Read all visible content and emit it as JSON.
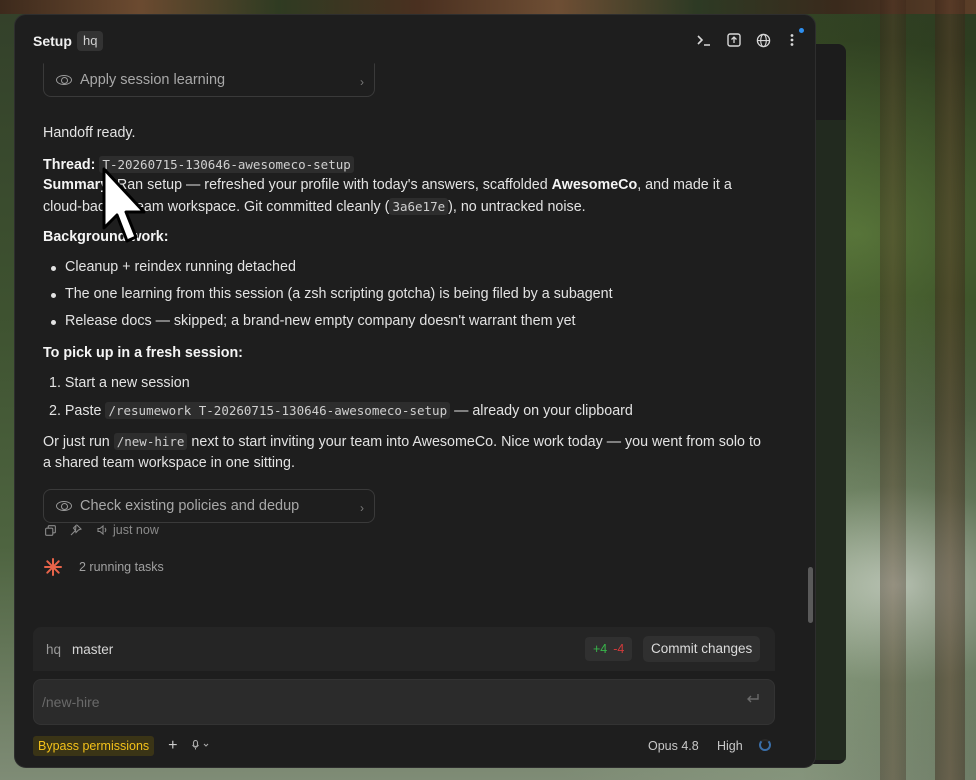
{
  "window": {
    "title": "Setup",
    "tag": "hq"
  },
  "toolbar": {
    "icons": [
      "terminal-icon",
      "export-icon",
      "globe-icon",
      "more-icon"
    ]
  },
  "top_pill": {
    "label": "Apply session learning"
  },
  "message": {
    "handoff": "Handoff ready.",
    "thread_label": "Thread:",
    "thread_id": "T-20260715-130646-awesomeco-setup",
    "summary_label": "Summary:",
    "summary_text_1": " Ran setup — refreshed your profile with today's answers, scaffolded ",
    "summary_company": "AwesomeCo",
    "summary_text_2": ", and made it a cloud-backed team workspace. Git committed cleanly (",
    "summary_commit": "3a6e17e",
    "summary_text_3": "), no untracked noise.",
    "background_label": "Background work:",
    "background_items": [
      "Cleanup + reindex running detached",
      "The one learning from this session (a zsh scripting gotcha) is being filed by a subagent",
      "Release docs — skipped; a brand-new empty company doesn't warrant them yet"
    ],
    "fresh_label": "To pick up in a fresh session:",
    "steps": {
      "s1": "1. Start a new session",
      "s2_prefix": "2. Paste ",
      "s2_code": "/resumework T-20260715-130646-awesomeco-setup",
      "s2_suffix": " — already on your clipboard"
    },
    "closing_prefix": "Or just run ",
    "closing_code": "/new-hire",
    "closing_suffix": " next to start inviting your team into AwesomeCo. Nice work today — you went from solo to a shared team workspace in one sitting."
  },
  "bottom_pill": {
    "label": "Check existing policies and dedup"
  },
  "meta": {
    "timestamp": "just now"
  },
  "running": {
    "label": "2 running tasks"
  },
  "git": {
    "repo": "hq",
    "branch": "master",
    "added": "+4",
    "removed": "-4",
    "commit_label": "Commit changes"
  },
  "composer": {
    "placeholder": "/new-hire"
  },
  "footer": {
    "permissions": "Bypass permissions",
    "plus": "+",
    "model": "Opus 4.8",
    "effort": "High"
  },
  "colors": {
    "accent_warning": "#f3c11a",
    "diff_add": "#38b64a",
    "diff_remove": "#d23a3a",
    "spark": "#e8644a"
  }
}
